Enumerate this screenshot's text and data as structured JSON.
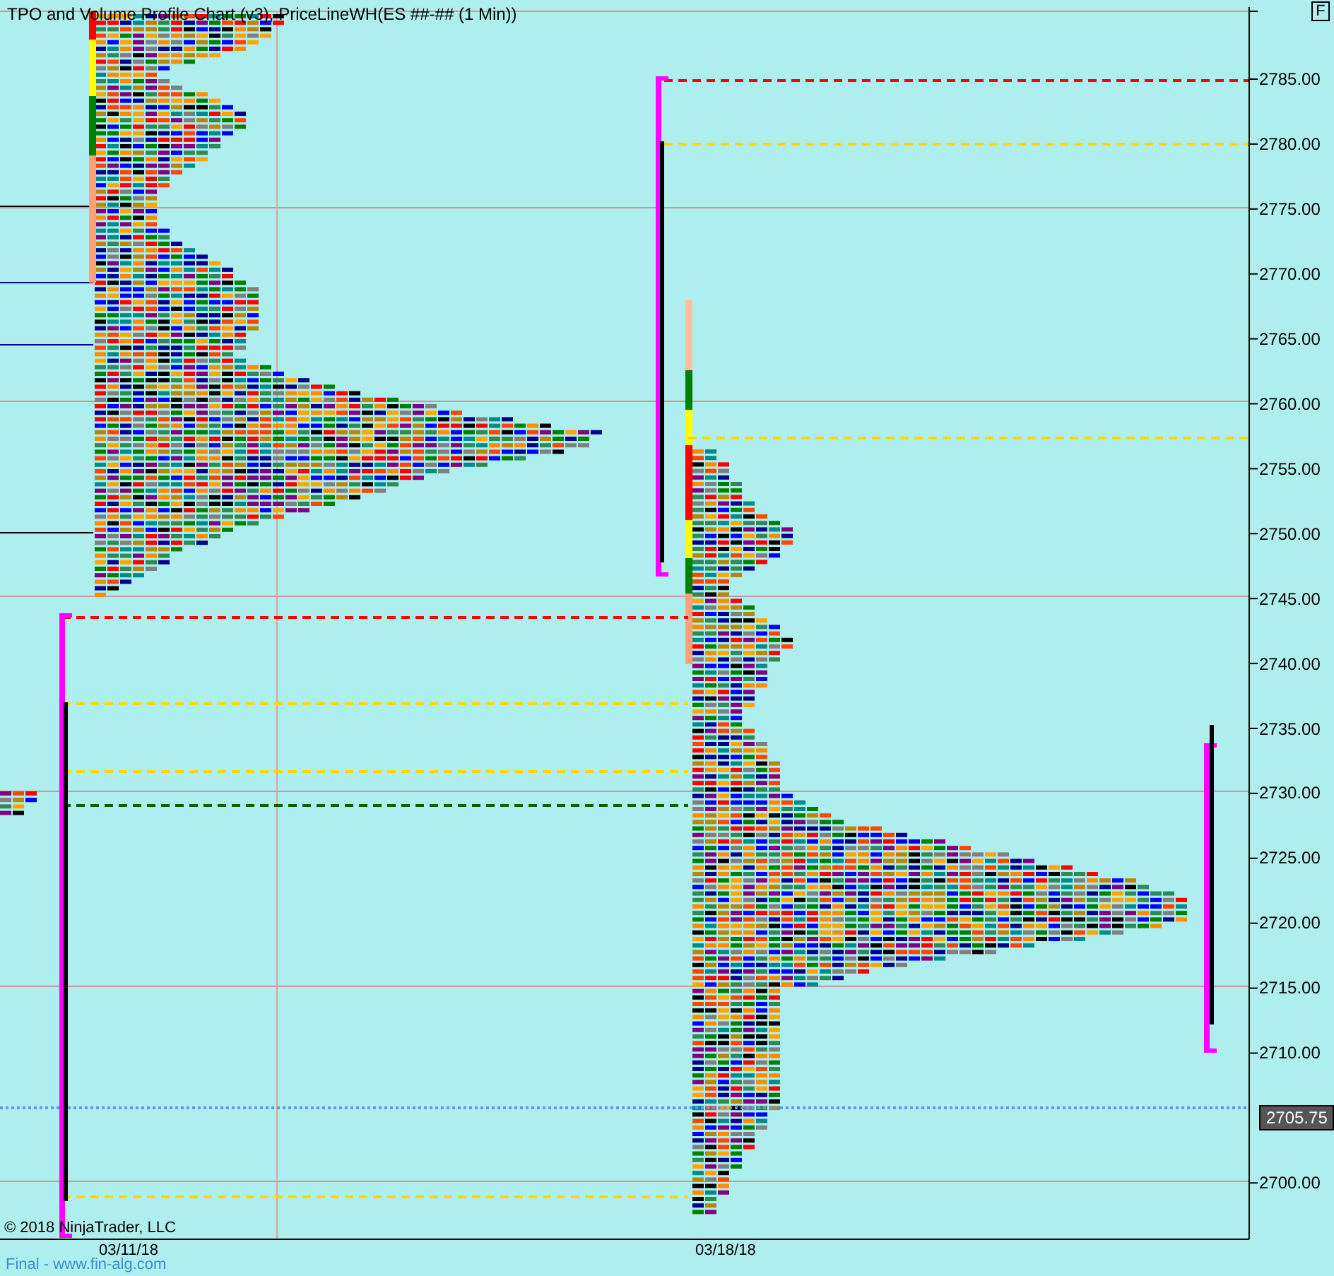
{
  "chart": {
    "title": "TPO and Volume Profile Chart (v3), PriceLineWH(ES ##-## (1 Min))",
    "price_labels": [
      "2785.00",
      "2780.00",
      "2775.00",
      "2770.00",
      "2765.00",
      "2760.00",
      "2755.00",
      "2750.00",
      "2745.00",
      "2740.00",
      "2735.00",
      "2730.00",
      "2725.00",
      "2720.00",
      "2715.00",
      "2710.00",
      "2700.00"
    ],
    "current_price": "2705.75",
    "copyright": "© 2018 NinjaTrader, LLC",
    "dates": [
      "03/11/18",
      "03/18/18"
    ]
  },
  "toolbar": {
    "button": "F"
  },
  "footer": "Final - www.fin-alg.com"
}
